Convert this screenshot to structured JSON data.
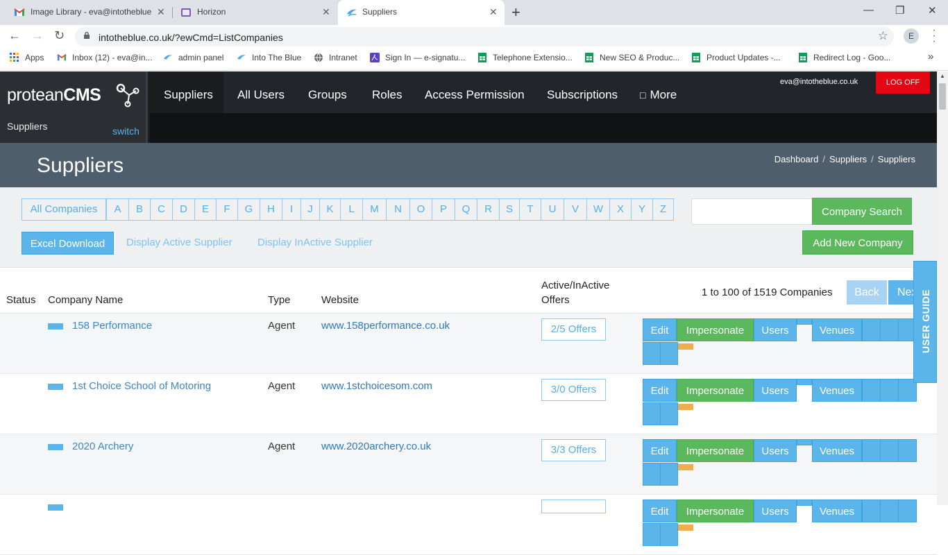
{
  "browser": {
    "tabs": [
      {
        "title": "Image Library - eva@intotheblue",
        "icon": "gmail-icon"
      },
      {
        "title": "Horizon",
        "icon": "horizon-icon"
      },
      {
        "title": "Suppliers",
        "icon": "intotheblue-icon"
      }
    ],
    "url": "intotheblue.co.uk/?ewCmd=ListCompanies",
    "profile_initial": "E",
    "bookmarks": [
      {
        "label": "Apps",
        "icon": "apps-grid-icon"
      },
      {
        "label": "Inbox (12) - eva@in...",
        "icon": "gmail-icon"
      },
      {
        "label": "admin panel",
        "icon": "intotheblue-icon"
      },
      {
        "label": "Into The Blue",
        "icon": "intotheblue-icon"
      },
      {
        "label": "Intranet",
        "icon": "globe-icon"
      },
      {
        "label": "Sign In — e-signatu...",
        "icon": "pdf-icon"
      },
      {
        "label": "Telephone Extensio...",
        "icon": "sheets-icon"
      },
      {
        "label": "New SEO & Produc...",
        "icon": "sheets-icon"
      },
      {
        "label": "Product Updates -...",
        "icon": "sheets-icon"
      },
      {
        "label": "Redirect Log - Goo...",
        "icon": "sheets-icon"
      }
    ],
    "bookmarks_more": "»"
  },
  "cms": {
    "logo_light": "protean",
    "logo_bold": "CMS",
    "section": "Suppliers",
    "switch": "switch",
    "nav": [
      "Suppliers",
      "All Users",
      "Groups",
      "Roles",
      "Access Permission",
      "Subscriptions",
      "More"
    ],
    "more_icon": "□",
    "user_email": "eva@intotheblue.co.uk",
    "log_off": "LOG OFF"
  },
  "page": {
    "title": "Suppliers",
    "breadcrumb": [
      "Dashboard",
      "Suppliers",
      "Suppliers"
    ]
  },
  "filters": {
    "all": "All Companies",
    "letters": [
      "A",
      "B",
      "C",
      "D",
      "E",
      "F",
      "G",
      "H",
      "I",
      "J",
      "K",
      "L",
      "M",
      "N",
      "O",
      "P",
      "Q",
      "R",
      "S",
      "T",
      "U",
      "V",
      "W",
      "X",
      "Y",
      "Z"
    ],
    "search_value": "",
    "search_button": "Company Search",
    "excel": "Excel Download",
    "active_link": "Display Active Supplier",
    "inactive_link": "Display InActive Supplier",
    "add_new": "Add New Company"
  },
  "table": {
    "headers": {
      "status": "Status",
      "name": "Company Name",
      "type": "Type",
      "website": "Website",
      "offers_1": "Active/InActive",
      "offers_2": "Offers"
    },
    "count": "1 to 100 of 1519  Companies",
    "back": "Back",
    "next": "Next",
    "actions": {
      "edit": "Edit",
      "impersonate": "Impersonate",
      "users": "Users",
      "venues": "Venues"
    },
    "rows": [
      {
        "name": "158 Performance",
        "type": "Agent",
        "website": "www.158performance.co.uk",
        "offers": "2/5 Offers"
      },
      {
        "name": "1st Choice School of Motoring",
        "type": "Agent",
        "website": "www.1stchoicesom.com",
        "offers": "3/0 Offers"
      },
      {
        "name": "2020 Archery",
        "type": "Agent",
        "website": "www.2020archery.co.uk",
        "offers": "3/3 Offers"
      },
      {
        "name": "",
        "type": "",
        "website": "",
        "offers": ""
      }
    ]
  },
  "user_guide": "USER GUIDE",
  "colors": {
    "accent_blue": "#5bb5ea",
    "green": "#5cb85c",
    "logoff_red": "#e30613",
    "title_bar": "#4e5e6d"
  }
}
